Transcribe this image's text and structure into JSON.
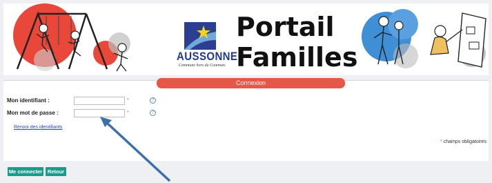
{
  "header": {
    "logo_wordmark": "AUSSONNE",
    "logo_tagline": "Commune hors du Commun.",
    "title_line1": "Portail",
    "title_line2": "Familles",
    "left_illustration": "children-on-swing-illustration",
    "right_illustration": "family-and-child-at-board-illustration",
    "logo_icon": "aussonne-logo-star-icon",
    "colors": {
      "accent_red": "#e8564a",
      "brand_blue": "#1f3b8f",
      "star_yellow": "#f2d21c"
    }
  },
  "tab": {
    "label": "Connexion"
  },
  "form": {
    "identifiant_label": "Mon identifiant :",
    "identifiant_value": "",
    "password_label": "Mon mot de passe :",
    "password_value": "",
    "required_marker": "*",
    "help_icon": "help-icon",
    "renvoi_link": "Renvoi des identifiants",
    "required_note": "champs obligatoires"
  },
  "buttons": {
    "connect": "Me connecter",
    "back": "Retour"
  },
  "annotation": {
    "arrow_color": "#3d6fa8"
  }
}
